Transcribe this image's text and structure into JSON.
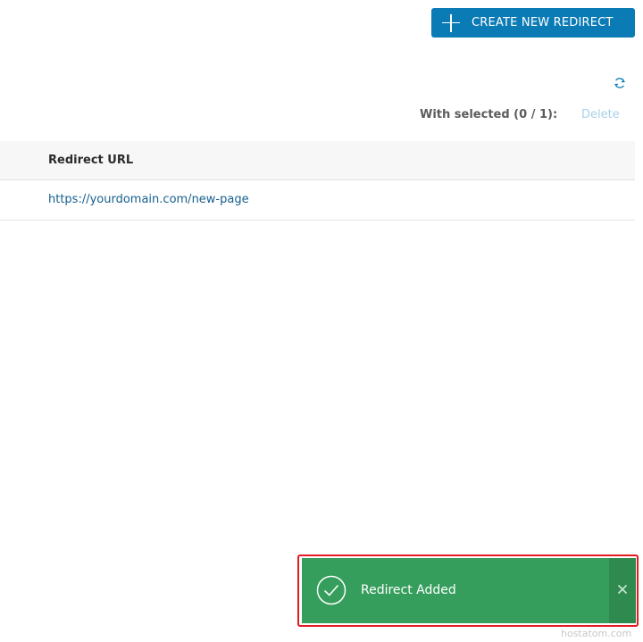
{
  "toolbar": {
    "create_label": "CREATE NEW REDIRECT",
    "create_icon": "plus-icon",
    "refresh_icon": "refresh-icon"
  },
  "selection": {
    "with_selected_label": "With selected (0 / 1):",
    "delete_label": "Delete"
  },
  "table": {
    "columns": [
      "Redirect URL"
    ],
    "rows": [
      {
        "redirect_url": "https://yourdomain.com/new-page"
      }
    ]
  },
  "toast": {
    "message": "Redirect Added",
    "status_icon": "check-circle-icon",
    "close_icon": "close-icon"
  },
  "watermark": "hostatom.com",
  "colors": {
    "primary": "#0b7bb6",
    "link": "#16608f",
    "success": "#369e5c",
    "success_dark": "#2e8a4f",
    "highlight_border": "#e31b23",
    "disabled_text": "#a9d0e8"
  }
}
